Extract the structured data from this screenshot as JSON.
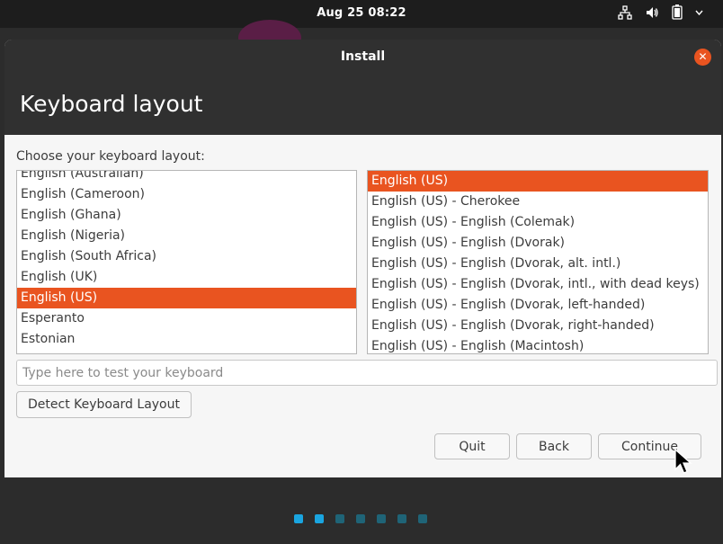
{
  "topbar": {
    "clock": "Aug 25  08:22",
    "icons": [
      "network-icon",
      "volume-icon",
      "battery-icon"
    ]
  },
  "window": {
    "title": "Install",
    "close_icon": "close-icon",
    "heading": "Keyboard layout"
  },
  "layout_prompt": "Choose your keyboard layout:",
  "layouts": [
    "English (Australian)",
    "English (Cameroon)",
    "English (Ghana)",
    "English (Nigeria)",
    "English (South Africa)",
    "English (UK)",
    "English (US)",
    "Esperanto",
    "Estonian"
  ],
  "selected_layout": "English (US)",
  "variants": [
    "English (US)",
    "English (US) - Cherokee",
    "English (US) - English (Colemak)",
    "English (US) - English (Dvorak)",
    "English (US) - English (Dvorak, alt. intl.)",
    "English (US) - English (Dvorak, intl., with dead keys)",
    "English (US) - English (Dvorak, left-handed)",
    "English (US) - English (Dvorak, right-handed)",
    "English (US) - English (Macintosh)"
  ],
  "selected_variant": "English (US)",
  "test_input": {
    "placeholder": "Type here to test your keyboard",
    "value": ""
  },
  "buttons": {
    "detect": "Detect Keyboard Layout",
    "quit": "Quit",
    "back": "Back",
    "continue": "Continue"
  },
  "progress": {
    "total_steps": 7,
    "completed_steps": 2
  },
  "colors": {
    "accent": "#e95420",
    "header_bg": "#303030",
    "step_done": "#1aa5e0",
    "step_pending": "#1f6477"
  }
}
